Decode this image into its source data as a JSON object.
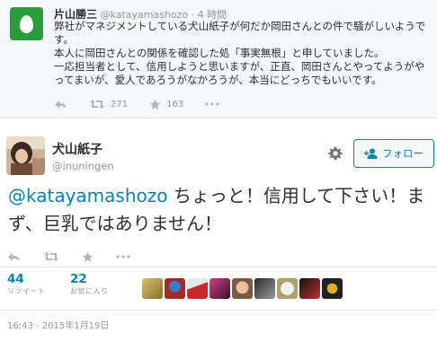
{
  "parent_tweet": {
    "name": "片山勝三",
    "handle": "@katayamashozo",
    "time": "· 4 時間",
    "lines": [
      "弊社がマネジメントしている犬山紙子が何だか岡田さんとの件で騒がしいようです。",
      "本人に岡田さんとの関係を確認した処「事実無根」と申していました。",
      "一応担当者として、信用しようと思いますが、正直、岡田さんとやってようがやってまいが、愛人であろうがなかろうが、本当にどっちでもいいです。"
    ],
    "retweet_count": "271",
    "favorite_count": "163"
  },
  "main_tweet": {
    "name": "犬山紙子",
    "handle": "@inuningen",
    "follow_label": "フォロー",
    "mention": "@katayamashozo",
    "text": " ちょっと！信用して下さい！まず、巨乳ではありません！",
    "retweets_count": "44",
    "retweets_label": "リツイート",
    "favorites_count": "22",
    "favorites_label": "お気に入り",
    "timestamp": "16:43 - 2015年1月19日"
  },
  "colors": {
    "link": "#0084b4",
    "muted": "#8899a6",
    "text": "#292f33",
    "egg": "#2a9d3b"
  },
  "icons": [
    "reply-icon",
    "retweet-icon",
    "star-icon",
    "more-icon",
    "gear-icon",
    "follow-person-icon"
  ]
}
